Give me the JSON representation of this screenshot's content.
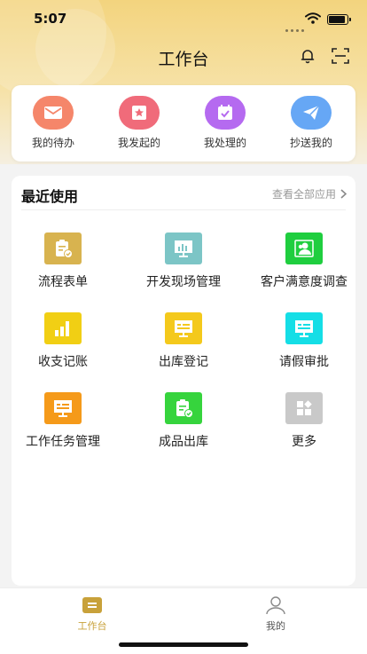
{
  "status_bar": {
    "time": "5:07"
  },
  "header": {
    "title": "工作台"
  },
  "quick_actions": [
    {
      "label": "我的待办",
      "icon": "mail-icon",
      "color": "#f5866a"
    },
    {
      "label": "我发起的",
      "icon": "star-card-icon",
      "color": "#f06b7a"
    },
    {
      "label": "我处理的",
      "icon": "calendar-check-icon",
      "color": "#b56af0"
    },
    {
      "label": "抄送我的",
      "icon": "paper-plane-icon",
      "color": "#66a7f5"
    }
  ],
  "recent": {
    "title": "最近使用",
    "view_all": "查看全部应用",
    "apps": [
      {
        "label": "流程表单",
        "icon": "clipboard-check-icon",
        "color": "#d8b34f"
      },
      {
        "label": "开发现场管理",
        "icon": "board-chart-icon",
        "color": "#7cc5c6"
      },
      {
        "label": "客户满意度调查",
        "icon": "users-icon",
        "color": "#1fce3f"
      },
      {
        "label": "收支记账",
        "icon": "bar-chart-icon",
        "color": "#f1cf14"
      },
      {
        "label": "出库登记",
        "icon": "monitor-icon",
        "color": "#f4c91c"
      },
      {
        "label": "请假审批",
        "icon": "monitor-icon",
        "color": "#15dee6"
      },
      {
        "label": "工作任务管理",
        "icon": "monitor-icon",
        "color": "#f59a1a"
      },
      {
        "label": "成品出库",
        "icon": "clipboard-check-icon",
        "color": "#36d43d"
      },
      {
        "label": "更多",
        "icon": "grid-icon",
        "color": "#c9c9c9"
      }
    ]
  },
  "tabbar": {
    "items": [
      {
        "label": "工作台",
        "active": true,
        "color": "#c8a13a"
      },
      {
        "label": "我的",
        "active": false,
        "color": "#555555"
      }
    ]
  }
}
